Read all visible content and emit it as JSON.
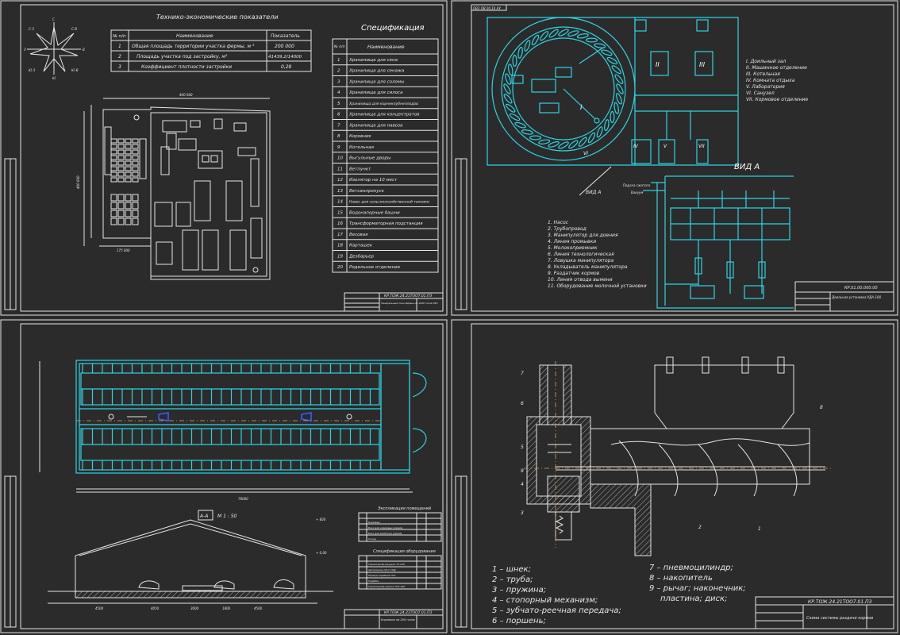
{
  "sheet1": {
    "tep_title": "Технико-экономические показатели",
    "tep_headers": [
      "№ п/п",
      "Наименование",
      "Показатель"
    ],
    "tep_rows": [
      [
        "1",
        "Общая площадь территории участка фермы, м ²",
        "200 000"
      ],
      [
        "2",
        "Площадь участка под застройку, м²",
        "41439,2/14000"
      ],
      [
        "3",
        "Коэффициент плотности застройки",
        "0,28"
      ]
    ],
    "spec_title": "Спецификация",
    "spec_headers": [
      "№ п/п",
      "Наименование"
    ],
    "spec_rows": [
      [
        "1",
        "Хранилища для сена"
      ],
      [
        "2",
        "Хранилища для сенажа"
      ],
      [
        "3",
        "Хранилища для соломы"
      ],
      [
        "4",
        "Хранилища для силоса"
      ],
      [
        "5",
        "Хранилища для корнеклубнеплодов"
      ],
      [
        "6",
        "Хранилища для концентратов"
      ],
      [
        "7",
        "Хранилища для навоза"
      ],
      [
        "8",
        "Коровник"
      ],
      [
        "9",
        "Котельная"
      ],
      [
        "10",
        "Выгульные дворы"
      ],
      [
        "11",
        "Ветпункт"
      ],
      [
        "12",
        "Изолятор на 10 мест"
      ],
      [
        "13",
        "Ветсанпропуск"
      ],
      [
        "14",
        "Навес для сельскохозяйственной техники"
      ],
      [
        "15",
        "Водонапорные башни"
      ],
      [
        "16",
        "Трансформаторная подстанция"
      ],
      [
        "17",
        "Весовая"
      ],
      [
        "18",
        "Карташек"
      ],
      [
        "19",
        "Дезбарьер"
      ],
      [
        "20",
        "Родильное отделение"
      ]
    ],
    "stamp_code": "КР.ТОЖ.24.21ТОО7.01.ПЗ",
    "stamp_name": "Генеральный план фермы на 1000 голов КРС",
    "dim_top": "400 000",
    "dim_left": "400 000",
    "dim_bottom": "175 000"
  },
  "sheet2": {
    "corner_code": "ОВЗ ОВ 00.10 АУ",
    "roman": [
      "I",
      "II",
      "III",
      "IV",
      "V",
      "VI",
      "VII"
    ],
    "legend_roman": [
      "I. Доильный зал",
      "II. Машинное отделение",
      "III. Котельная",
      "IV. Комната отдыха",
      "V. Лаборатория",
      "VI. Санузел",
      "VII. Кормовое отделение"
    ],
    "view_label": "ВИД А",
    "view_label_small": "ВИД А",
    "pipe_label_1": "Подача сжатого",
    "pipe_label_2": "Вакуум",
    "legend_items": [
      "1. Насос",
      "2. Трубопровод",
      "3. Манипулятор для доения",
      "4. Линия промывки",
      "5. Молокоприемник",
      "6. Линия технологическая",
      "7. Ловушка манипулятора",
      "8. Укладыватель манипулятора",
      "9. Раздатчик кормов",
      "10. Линия отвода вымени",
      "11. Оборудование молочной установки"
    ],
    "stamp_code": "КР.01.00.000.00",
    "stamp_name": "Доильная установка УДА-100"
  },
  "sheet3": {
    "overall_dim": "78000",
    "section_label": "А-А",
    "section_scale": "М 1 : 50",
    "level_top": "+ 600",
    "level_mid": "+ 0,00",
    "table1_title": "Экспликация помещений",
    "table1_rows": [
      "Коровник",
      "Бокс для кормовых кормов",
      "Бокс для ветбоксы кормов",
      "Склад"
    ],
    "table2_title": "Спецификация оборудования",
    "table2_rows": [
      "Транспортёр раздачи ТС-250",
      "Автопоилка АП-1 СКД",
      "Привод скребков ТСН",
      "Скребки",
      "Транспортёр навоза ТСН-160"
    ],
    "stamp_code": "КР.ТОЖ.24.21ТОО7.01.ПЗ",
    "stamp_name": "Коровник на 200 голов",
    "bottom_dims": [
      "4500",
      "4050",
      "3000",
      "1800",
      "4500"
    ]
  },
  "sheet4": {
    "callouts": [
      "7",
      "6",
      "5",
      "9",
      "4",
      "3",
      "8",
      "1",
      "2"
    ],
    "legend_left": [
      "1 – шнек;",
      "2 – труба;",
      "3 – пружина;",
      "4 – стопорный механизм;",
      "5 – зубчато-реечная передача;",
      "6 – поршень;"
    ],
    "legend_right": [
      "7 – пневмоцилиндр;",
      "8 – накопитель",
      "9 – рычаг; наконечник;",
      "пластина;    диск;"
    ],
    "stamp_code": "КР.ТОЖ.24.21ТОО7.01.ПЗ",
    "stamp_name": "Схема системы раздачи кормов"
  },
  "colors": {
    "background": "#2b2b2b",
    "lines": "#e6e6e6",
    "cyan": "#2fd3e0",
    "blue": "#3a5bff",
    "axis": "#d8a45a"
  }
}
